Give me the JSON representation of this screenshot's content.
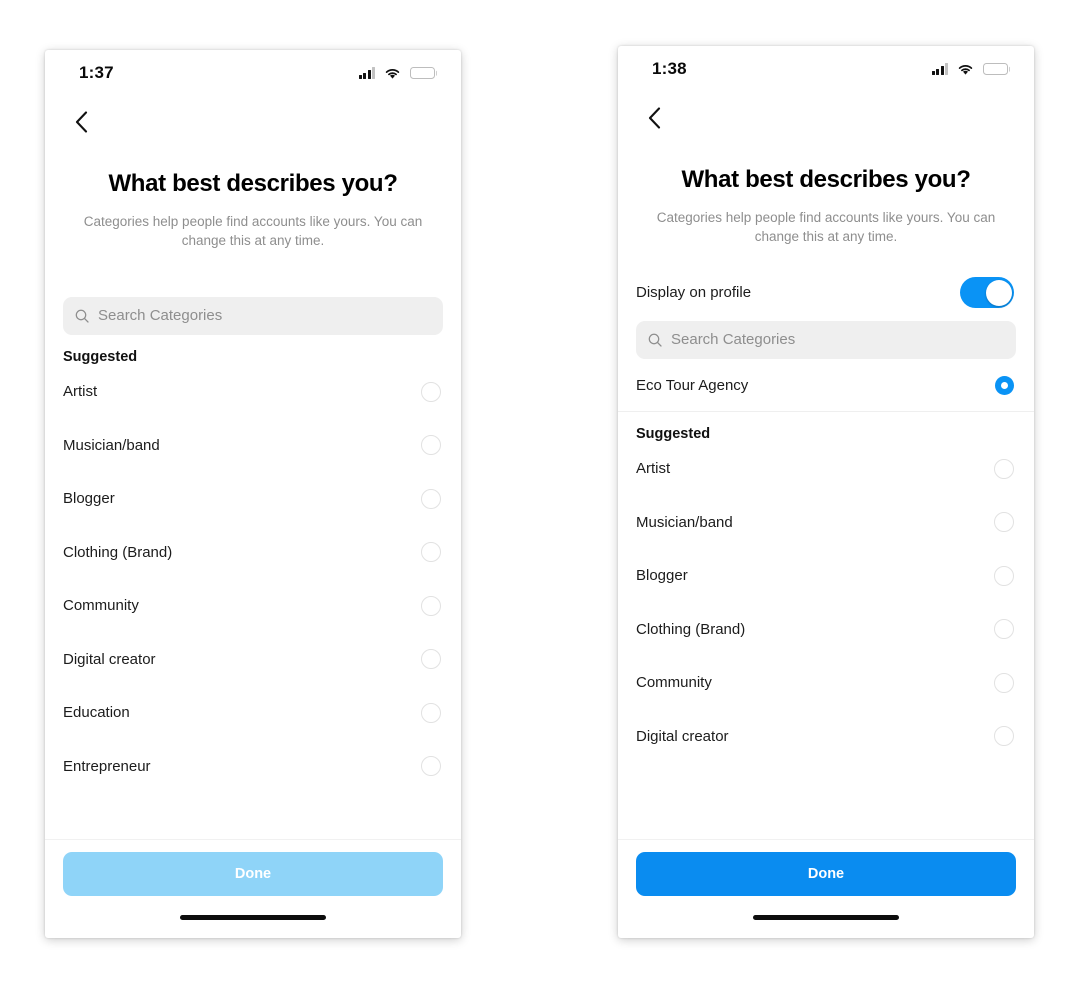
{
  "app": {
    "brand_blue": "#0a93f5",
    "done_disabled_blue": "#8fd4f8",
    "done_enabled_blue": "#0a8cf0",
    "search_field_bg": "#efefef",
    "muted_text": "#8e8e8e"
  },
  "screens": [
    {
      "id": "left",
      "status_bar": {
        "time": "1:37",
        "signal_icon": "cellular-signal-icon",
        "wifi_icon": "wifi-icon",
        "battery_icon": "battery-icon",
        "battery_level": 65
      },
      "back_icon": "chevron-left-icon",
      "title": "What best describes you?",
      "subtitle": "Categories help people find accounts like yours. You can change this at any time.",
      "has_display_toggle": false,
      "search": {
        "placeholder": "Search Categories",
        "value": "",
        "icon": "search-icon"
      },
      "selected_category": null,
      "section_label": "Suggested",
      "categories": [
        {
          "label": "Artist",
          "selected": false
        },
        {
          "label": "Musician/band",
          "selected": false
        },
        {
          "label": "Blogger",
          "selected": false
        },
        {
          "label": "Clothing (Brand)",
          "selected": false
        },
        {
          "label": "Community",
          "selected": false
        },
        {
          "label": "Digital creator",
          "selected": false
        },
        {
          "label": "Education",
          "selected": false
        },
        {
          "label": "Entrepreneur",
          "selected": false
        }
      ],
      "done_label": "Done",
      "done_enabled": false
    },
    {
      "id": "right",
      "status_bar": {
        "time": "1:38",
        "signal_icon": "cellular-signal-icon",
        "wifi_icon": "wifi-icon",
        "battery_icon": "battery-icon",
        "battery_level": 65
      },
      "back_icon": "chevron-left-icon",
      "title": "What best describes you?",
      "subtitle": "Categories help people find accounts like yours. You can change this at any time.",
      "has_display_toggle": true,
      "display_toggle": {
        "label": "Display on profile",
        "on": true
      },
      "search": {
        "placeholder": "Search Categories",
        "value": "",
        "icon": "search-icon"
      },
      "selected_category": {
        "label": "Eco Tour Agency",
        "selected": true
      },
      "section_label": "Suggested",
      "categories": [
        {
          "label": "Artist",
          "selected": false
        },
        {
          "label": "Musician/band",
          "selected": false
        },
        {
          "label": "Blogger",
          "selected": false
        },
        {
          "label": "Clothing (Brand)",
          "selected": false
        },
        {
          "label": "Community",
          "selected": false
        },
        {
          "label": "Digital creator",
          "selected": false
        }
      ],
      "done_label": "Done",
      "done_enabled": true
    }
  ]
}
